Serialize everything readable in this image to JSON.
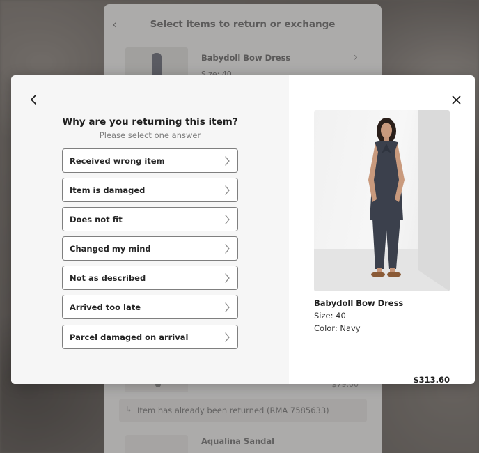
{
  "background_page": {
    "title": "Select items to return or exchange",
    "items": [
      {
        "name": "Babydoll Bow Dress",
        "size": "Size: 40"
      }
    ],
    "price_partial": "$79.00",
    "returned_notice": "Item has already been returned (RMA 7585633)",
    "next_item_name": "Aqualina Sandal"
  },
  "modal": {
    "question": "Why are you returning this item?",
    "subtitle": "Please select one answer",
    "reasons": [
      "Received wrong item",
      "Item is damaged",
      "Does not fit",
      "Changed my mind",
      "Not as described",
      "Arrived too late",
      "Parcel damaged on arrival"
    ],
    "product": {
      "name": "Babydoll Bow Dress",
      "size": "Size: 40",
      "color": "Color: Navy",
      "price": "$313.60"
    }
  },
  "colors": {
    "modal_left_bg": "#f6f6f6",
    "border": "#7f7f7f",
    "text": "#1f1f1f"
  },
  "icons": {
    "back": "chevron-left-icon",
    "close": "close-icon",
    "reason": "chevron-right-icon"
  }
}
